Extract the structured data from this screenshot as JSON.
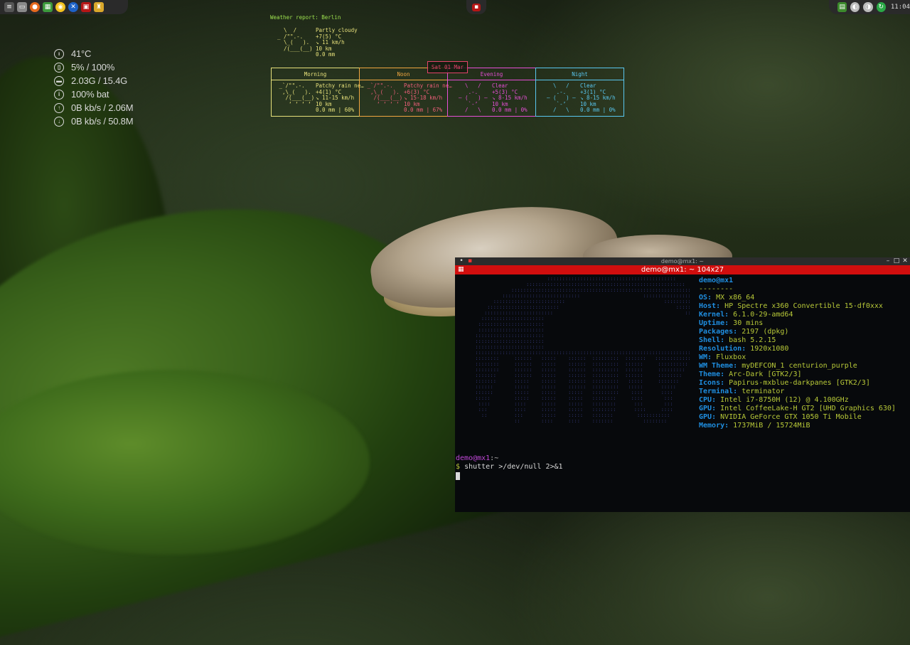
{
  "conky": {
    "temp": "41°C",
    "cpu": "5% / 100%",
    "mem": "2.03G / 15.4G",
    "battery": "100% bat",
    "upload": "0B kb/s / 2.06M",
    "download": "0B kb/s / 50.8M"
  },
  "weather": {
    "title": "Weather report: Berlin",
    "now_art": "  \\  /\n_ /\"\".-.\n  \\_(   ).\n  /(___(__)",
    "now_text": "Partly cloudy\n+7(5) °C\n↘ 11 km/h\n10 km\n0.0 mm",
    "date": "Sat 01 Mar",
    "periods": [
      {
        "label": "Morning",
        "art": " _`/\"\".-.\n  ,\\_(   ).\n   /(___(__)\n    ‘ ‘ ‘ ‘",
        "text": "Patchy rain ne…\n+4(1) °C\n↘ 11-15 km/h\n10 km\n0.0 mm | 60%"
      },
      {
        "label": "Noon",
        "art": " _`/\"\".-.\n  ,\\_(   ).\n   /(___(__)\n    ‘ ‘ ‘ ‘",
        "text": "Patchy rain ne…\n+6(3) °C\n↘ 15-18 km/h\n10 km\n0.0 mm | 67%"
      },
      {
        "label": "Evening",
        "art": "    \\   /\n     .-.\n  ― (   ) ―\n     `-’\n    /   \\",
        "text": "Clear\n+5(3) °C\n↘ 8-15 km/h\n10 km\n0.0 mm | 0%"
      },
      {
        "label": "Night",
        "art": "    \\   /\n     .-.\n  ― (   ) ―\n     `-’\n    /   \\",
        "text": "Clear\n+3(1) °C\n↘ 8-15 km/h\n10 km\n0.0 mm | 0%"
      }
    ]
  },
  "terminal": {
    "title_small": "demo@mx1: ~",
    "title": "demo@mx1: ~ 104x27",
    "user_host": "demo@mx1",
    "separator": "--------",
    "info": [
      {
        "key": "OS",
        "value": "MX x86_64"
      },
      {
        "key": "Host",
        "value": "HP Spectre x360 Convertible 15-df0xxx"
      },
      {
        "key": "Kernel",
        "value": "6.1.0-29-amd64"
      },
      {
        "key": "Uptime",
        "value": "30 mins"
      },
      {
        "key": "Packages",
        "value": "2197 (dpkg)"
      },
      {
        "key": "Shell",
        "value": "bash 5.2.15"
      },
      {
        "key": "Resolution",
        "value": "1920x1080"
      },
      {
        "key": "WM",
        "value": "Fluxbox"
      },
      {
        "key": "WM Theme",
        "value": "myDEFCON_1 centurion_purple"
      },
      {
        "key": "Theme",
        "value": "Arc-Dark [GTK2/3]"
      },
      {
        "key": "Icons",
        "value": "Papirus-mxblue-darkpanes [GTK2/3]"
      },
      {
        "key": "Terminal",
        "value": "terminator"
      },
      {
        "key": "CPU",
        "value": "Intel i7-8750H (12) @ 4.100GHz"
      },
      {
        "key": "GPU",
        "value": "Intel CoffeeLake-H GT2 [UHD Graphics 630]"
      },
      {
        "key": "GPU",
        "value": "NVIDIA GeForce GTX 1050 Ti Mobile"
      },
      {
        "key": "Memory",
        "value": "1737MiB / 15724MiB"
      }
    ],
    "prompt_user": "demo@mx1",
    "prompt_path": ":~",
    "prompt_symbol": "$",
    "command": "shutter >/dev/null 2>&1"
  },
  "panel": {
    "clock": "11:04"
  },
  "colors": {
    "weather_head": [
      "#e6e07a",
      "#f0a640",
      "#e64fd6",
      "#59c7f0"
    ],
    "terminal_title_bar": "#d10e0e"
  }
}
